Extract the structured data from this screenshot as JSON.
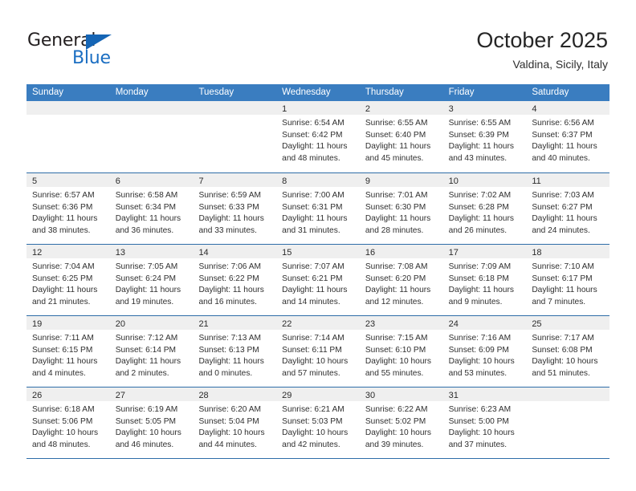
{
  "logo": {
    "word_one": "General",
    "word_two": "Blue",
    "triangle_color": "#1565b5",
    "blue_color": "#1b6ec2"
  },
  "header": {
    "title": "October 2025",
    "location": "Valdina, Sicily, Italy"
  },
  "theme": {
    "header_row_color": "#3a7dc0",
    "row_divider_color": "#2e6da8",
    "day_head_color": "#efefef"
  },
  "weekdays": [
    "Sunday",
    "Monday",
    "Tuesday",
    "Wednesday",
    "Thursday",
    "Friday",
    "Saturday"
  ],
  "weeks": [
    [
      {
        "day": "",
        "lines": []
      },
      {
        "day": "",
        "lines": []
      },
      {
        "day": "",
        "lines": []
      },
      {
        "day": "1",
        "lines": [
          "Sunrise: 6:54 AM",
          "Sunset: 6:42 PM",
          "Daylight: 11 hours",
          "and 48 minutes."
        ]
      },
      {
        "day": "2",
        "lines": [
          "Sunrise: 6:55 AM",
          "Sunset: 6:40 PM",
          "Daylight: 11 hours",
          "and 45 minutes."
        ]
      },
      {
        "day": "3",
        "lines": [
          "Sunrise: 6:55 AM",
          "Sunset: 6:39 PM",
          "Daylight: 11 hours",
          "and 43 minutes."
        ]
      },
      {
        "day": "4",
        "lines": [
          "Sunrise: 6:56 AM",
          "Sunset: 6:37 PM",
          "Daylight: 11 hours",
          "and 40 minutes."
        ]
      }
    ],
    [
      {
        "day": "5",
        "lines": [
          "Sunrise: 6:57 AM",
          "Sunset: 6:36 PM",
          "Daylight: 11 hours",
          "and 38 minutes."
        ]
      },
      {
        "day": "6",
        "lines": [
          "Sunrise: 6:58 AM",
          "Sunset: 6:34 PM",
          "Daylight: 11 hours",
          "and 36 minutes."
        ]
      },
      {
        "day": "7",
        "lines": [
          "Sunrise: 6:59 AM",
          "Sunset: 6:33 PM",
          "Daylight: 11 hours",
          "and 33 minutes."
        ]
      },
      {
        "day": "8",
        "lines": [
          "Sunrise: 7:00 AM",
          "Sunset: 6:31 PM",
          "Daylight: 11 hours",
          "and 31 minutes."
        ]
      },
      {
        "day": "9",
        "lines": [
          "Sunrise: 7:01 AM",
          "Sunset: 6:30 PM",
          "Daylight: 11 hours",
          "and 28 minutes."
        ]
      },
      {
        "day": "10",
        "lines": [
          "Sunrise: 7:02 AM",
          "Sunset: 6:28 PM",
          "Daylight: 11 hours",
          "and 26 minutes."
        ]
      },
      {
        "day": "11",
        "lines": [
          "Sunrise: 7:03 AM",
          "Sunset: 6:27 PM",
          "Daylight: 11 hours",
          "and 24 minutes."
        ]
      }
    ],
    [
      {
        "day": "12",
        "lines": [
          "Sunrise: 7:04 AM",
          "Sunset: 6:25 PM",
          "Daylight: 11 hours",
          "and 21 minutes."
        ]
      },
      {
        "day": "13",
        "lines": [
          "Sunrise: 7:05 AM",
          "Sunset: 6:24 PM",
          "Daylight: 11 hours",
          "and 19 minutes."
        ]
      },
      {
        "day": "14",
        "lines": [
          "Sunrise: 7:06 AM",
          "Sunset: 6:22 PM",
          "Daylight: 11 hours",
          "and 16 minutes."
        ]
      },
      {
        "day": "15",
        "lines": [
          "Sunrise: 7:07 AM",
          "Sunset: 6:21 PM",
          "Daylight: 11 hours",
          "and 14 minutes."
        ]
      },
      {
        "day": "16",
        "lines": [
          "Sunrise: 7:08 AM",
          "Sunset: 6:20 PM",
          "Daylight: 11 hours",
          "and 12 minutes."
        ]
      },
      {
        "day": "17",
        "lines": [
          "Sunrise: 7:09 AM",
          "Sunset: 6:18 PM",
          "Daylight: 11 hours",
          "and 9 minutes."
        ]
      },
      {
        "day": "18",
        "lines": [
          "Sunrise: 7:10 AM",
          "Sunset: 6:17 PM",
          "Daylight: 11 hours",
          "and 7 minutes."
        ]
      }
    ],
    [
      {
        "day": "19",
        "lines": [
          "Sunrise: 7:11 AM",
          "Sunset: 6:15 PM",
          "Daylight: 11 hours",
          "and 4 minutes."
        ]
      },
      {
        "day": "20",
        "lines": [
          "Sunrise: 7:12 AM",
          "Sunset: 6:14 PM",
          "Daylight: 11 hours",
          "and 2 minutes."
        ]
      },
      {
        "day": "21",
        "lines": [
          "Sunrise: 7:13 AM",
          "Sunset: 6:13 PM",
          "Daylight: 11 hours",
          "and 0 minutes."
        ]
      },
      {
        "day": "22",
        "lines": [
          "Sunrise: 7:14 AM",
          "Sunset: 6:11 PM",
          "Daylight: 10 hours",
          "and 57 minutes."
        ]
      },
      {
        "day": "23",
        "lines": [
          "Sunrise: 7:15 AM",
          "Sunset: 6:10 PM",
          "Daylight: 10 hours",
          "and 55 minutes."
        ]
      },
      {
        "day": "24",
        "lines": [
          "Sunrise: 7:16 AM",
          "Sunset: 6:09 PM",
          "Daylight: 10 hours",
          "and 53 minutes."
        ]
      },
      {
        "day": "25",
        "lines": [
          "Sunrise: 7:17 AM",
          "Sunset: 6:08 PM",
          "Daylight: 10 hours",
          "and 51 minutes."
        ]
      }
    ],
    [
      {
        "day": "26",
        "lines": [
          "Sunrise: 6:18 AM",
          "Sunset: 5:06 PM",
          "Daylight: 10 hours",
          "and 48 minutes."
        ]
      },
      {
        "day": "27",
        "lines": [
          "Sunrise: 6:19 AM",
          "Sunset: 5:05 PM",
          "Daylight: 10 hours",
          "and 46 minutes."
        ]
      },
      {
        "day": "28",
        "lines": [
          "Sunrise: 6:20 AM",
          "Sunset: 5:04 PM",
          "Daylight: 10 hours",
          "and 44 minutes."
        ]
      },
      {
        "day": "29",
        "lines": [
          "Sunrise: 6:21 AM",
          "Sunset: 5:03 PM",
          "Daylight: 10 hours",
          "and 42 minutes."
        ]
      },
      {
        "day": "30",
        "lines": [
          "Sunrise: 6:22 AM",
          "Sunset: 5:02 PM",
          "Daylight: 10 hours",
          "and 39 minutes."
        ]
      },
      {
        "day": "31",
        "lines": [
          "Sunrise: 6:23 AM",
          "Sunset: 5:00 PM",
          "Daylight: 10 hours",
          "and 37 minutes."
        ]
      },
      {
        "day": "",
        "lines": []
      }
    ]
  ]
}
